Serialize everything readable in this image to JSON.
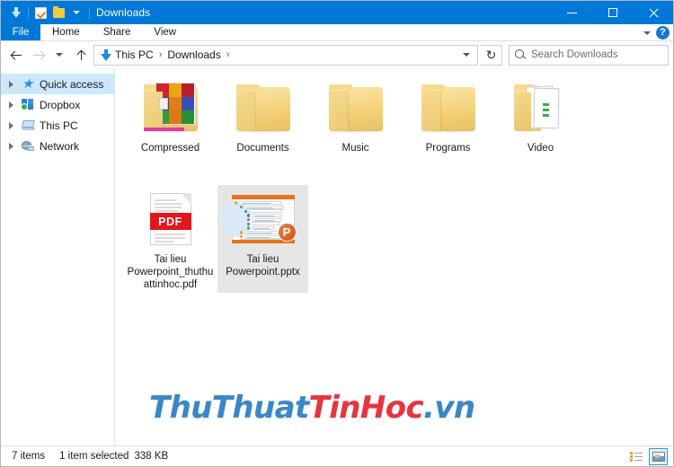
{
  "titlebar": {
    "window_title": "Downloads",
    "quick_access_icons": [
      "download-icon",
      "checkbox-icon",
      "folder-icon",
      "chevron-down-icon"
    ],
    "controls": {
      "minimize": "minimize-icon",
      "maximize": "maximize-icon",
      "close": "close-icon"
    },
    "accent_color": "#0078d7"
  },
  "ribbon": {
    "tabs": [
      {
        "label": "File",
        "active": true
      },
      {
        "label": "Home",
        "active": false
      },
      {
        "label": "Share",
        "active": false
      },
      {
        "label": "View",
        "active": false
      }
    ],
    "collapse_icon": "chevron-down-icon",
    "help_label": "?"
  },
  "address": {
    "back_icon": "arrow-left-icon",
    "forward_icon": "arrow-right-icon",
    "history_icon": "chevron-down-icon",
    "up_icon": "arrow-up-icon",
    "location_icon": "download-icon",
    "breadcrumbs": [
      "This PC",
      "Downloads"
    ],
    "separator": "›",
    "dropdown_icon": "chevron-down-icon",
    "refresh_icon": "↻"
  },
  "search": {
    "placeholder": "Search Downloads",
    "icon": "search-icon"
  },
  "sidebar": {
    "items": [
      {
        "label": "Quick access",
        "icon": "star-icon",
        "selected": true
      },
      {
        "label": "Dropbox",
        "icon": "dropbox-icon",
        "selected": false
      },
      {
        "label": "This PC",
        "icon": "computer-icon",
        "selected": false
      },
      {
        "label": "Network",
        "icon": "network-icon",
        "selected": false
      }
    ],
    "expander_icon": "chevron-right-icon",
    "selection_color": "#cce8ff"
  },
  "files": [
    {
      "name": "Compressed",
      "type": "folder-compressed",
      "selected": false
    },
    {
      "name": "Documents",
      "type": "folder",
      "selected": false
    },
    {
      "name": "Music",
      "type": "folder",
      "selected": false
    },
    {
      "name": "Programs",
      "type": "folder",
      "selected": false
    },
    {
      "name": "Video",
      "type": "folder-documents",
      "selected": false
    },
    {
      "name": "Tai lieu Powerpoint_thuthuattinhoc.pdf",
      "type": "pdf",
      "selected": false
    },
    {
      "name": "Tai lieu Powerpoint.pptx",
      "type": "pptx",
      "selected": true
    }
  ],
  "pdf_icon": {
    "badge_text": "PDF",
    "badge_color": "#e2161b"
  },
  "pptx_icon": {
    "badge_text": "P",
    "accent_color": "#e8721e"
  },
  "watermark": {
    "part1": "ThuThuat",
    "part2": "TinHoc",
    "part3": ".vn",
    "color1": "#3a87c8",
    "color2": "#e8343f"
  },
  "statusbar": {
    "item_count": "7 items",
    "selection": "1 item selected",
    "size": "338 KB",
    "views": [
      {
        "name": "details-view",
        "active": false
      },
      {
        "name": "large-icons-view",
        "active": true
      }
    ]
  }
}
